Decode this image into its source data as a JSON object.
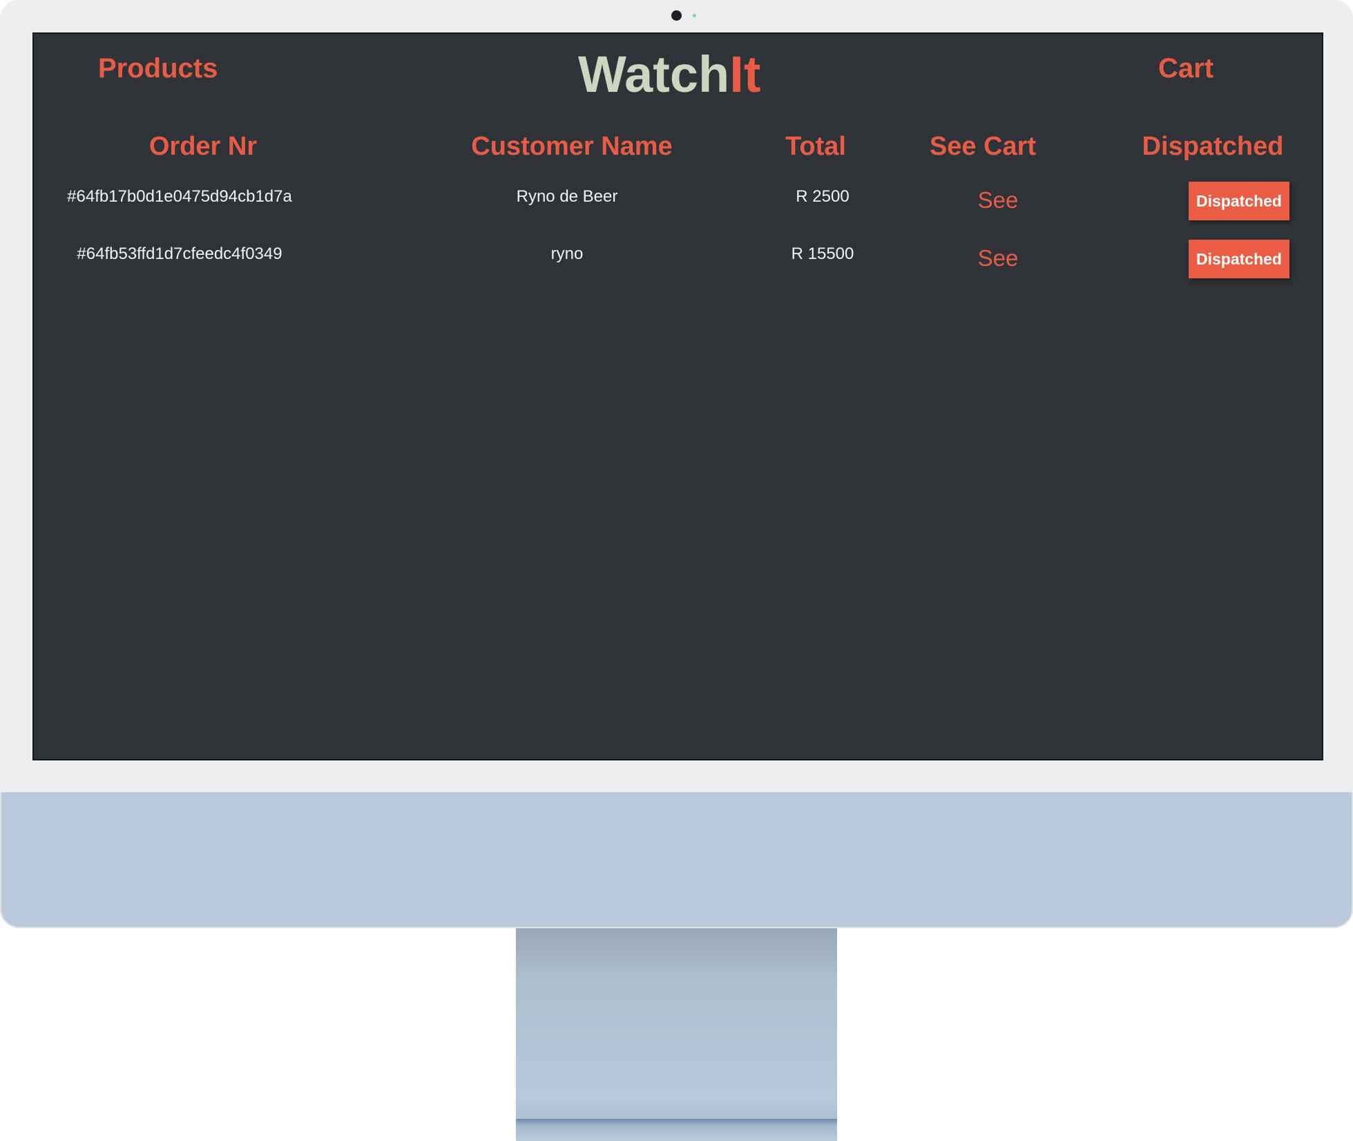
{
  "nav": {
    "products_label": "Products",
    "cart_label": "Cart",
    "logo_part1": "Watch",
    "logo_part2": "It"
  },
  "table": {
    "headers": [
      "Order Nr",
      "Customer Name",
      "Total",
      "See Cart",
      "Dispatched"
    ],
    "rows": [
      {
        "order_nr": "#64fb17b0d1e0475d94cb1d7a",
        "customer_name": "Ryno de Beer",
        "total": "R 2500",
        "see_label": "See",
        "dispatched_label": "Dispatched"
      },
      {
        "order_nr": "#64fb53ffd1d7cfeedc4f0349",
        "customer_name": "ryno",
        "total": "R 15500",
        "see_label": "See",
        "dispatched_label": "Dispatched"
      }
    ]
  },
  "colors": {
    "accent": "#e85b45",
    "logo_primary": "#cdd6c0",
    "screen_background": "#2f3338",
    "text": "#f2f2f2",
    "monitor_body": "#b8cadb",
    "bezel": "#eceef0"
  }
}
